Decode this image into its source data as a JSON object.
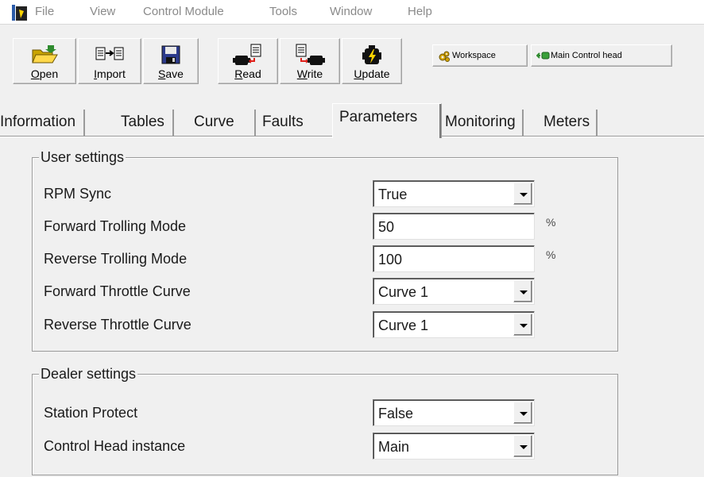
{
  "menu": {
    "items": [
      "File",
      "View",
      "Control Module",
      "Tools",
      "Window",
      "Help"
    ]
  },
  "toolbar": {
    "open_prefix": "",
    "open_ul": "O",
    "open_rest": "pen",
    "import_prefix": "",
    "import_ul": "I",
    "import_rest": "mport",
    "save_prefix": "",
    "save_ul": "S",
    "save_rest": "ave",
    "read_prefix": "",
    "read_ul": "R",
    "read_rest": "ead",
    "write_prefix": "",
    "write_ul": "W",
    "write_rest": "rite",
    "update_prefix": "",
    "update_ul": "U",
    "update_rest": "pdate",
    "workspace_label": "Workspace",
    "main_control_head_label": "Main Control head"
  },
  "tabs": [
    "Information",
    "Tables",
    "Curve",
    "Faults",
    "Parameters",
    "Monitoring",
    "Meters"
  ],
  "active_tab": "Parameters",
  "user_settings": {
    "title": "User settings",
    "rows": [
      {
        "label": "RPM Sync",
        "value": "True",
        "type": "dropdown",
        "unit": ""
      },
      {
        "label": "Forward Trolling Mode",
        "value": "50",
        "type": "text",
        "unit": "%"
      },
      {
        "label": "Reverse Trolling Mode",
        "value": "100",
        "type": "text",
        "unit": "%"
      },
      {
        "label": "Forward Throttle Curve",
        "value": "Curve 1",
        "type": "dropdown",
        "unit": ""
      },
      {
        "label": "Reverse Throttle Curve",
        "value": "Curve 1",
        "type": "dropdown",
        "unit": ""
      }
    ]
  },
  "dealer_settings": {
    "title": "Dealer settings",
    "rows": [
      {
        "label": "Station Protect",
        "value": "False",
        "type": "dropdown",
        "unit": ""
      },
      {
        "label": "Control Head instance",
        "value": "Main",
        "type": "dropdown",
        "unit": ""
      }
    ]
  },
  "colors": {
    "window_bg": "#f0f0f0",
    "menu_text": "#8a8a8a",
    "field_bg": "#ffffff",
    "border": "#9a9a9a"
  }
}
